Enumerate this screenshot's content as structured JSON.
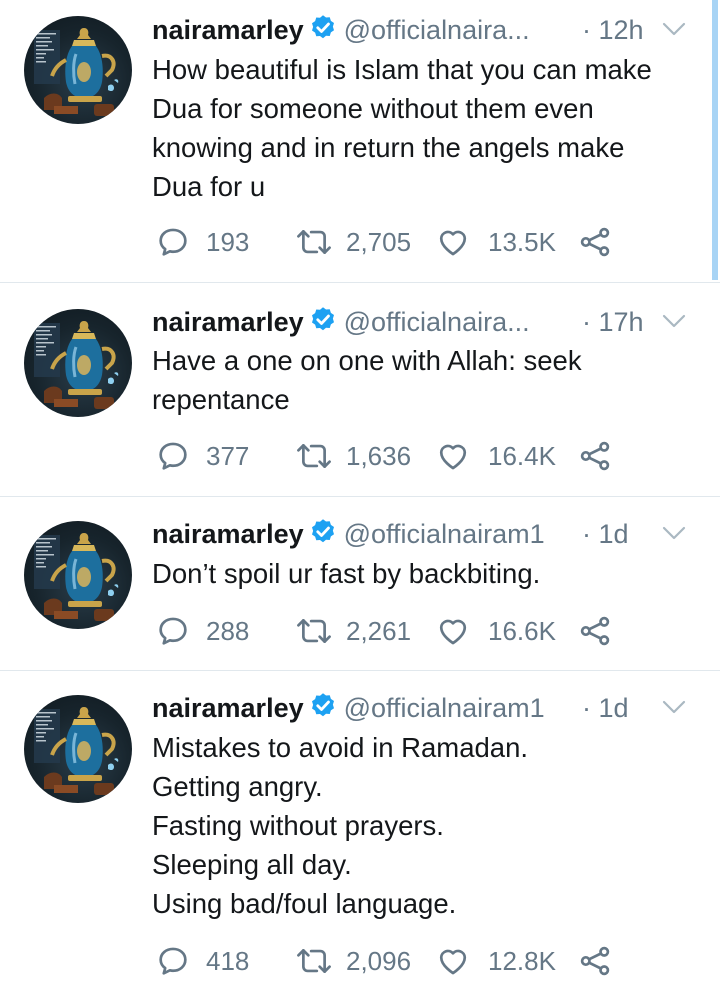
{
  "tweets": [
    {
      "name": "nairamarley",
      "handle": "@officialnaira...",
      "time": "· 12h",
      "lines": [
        "How beautiful is Islam that you can make",
        "Dua for someone without them even",
        "knowing and in return the angels make",
        "Dua for u"
      ],
      "replies": "193",
      "retweets": "2,705",
      "likes": "13.5K"
    },
    {
      "name": "nairamarley",
      "handle": "@officialnaira...",
      "time": "· 17h",
      "lines": [
        "Have a one on one with Allah: seek",
        "repentance"
      ],
      "replies": "377",
      "retweets": "1,636",
      "likes": "16.4K"
    },
    {
      "name": "nairamarley",
      "handle": "@officialnairam1",
      "time": "· 1d",
      "lines": [
        "Don’t spoil ur fast by backbiting."
      ],
      "replies": "288",
      "retweets": "2,261",
      "likes": "16.6K"
    },
    {
      "name": "nairamarley",
      "handle": "@officialnairam1",
      "time": "· 1d",
      "lines": [
        "Mistakes to avoid in Ramadan.",
        "Getting angry.",
        "Fasting without prayers.",
        "Sleeping all day.",
        "Using bad/foul language."
      ],
      "replies": "418",
      "retweets": "2,096",
      "likes": "12.8K"
    }
  ],
  "icons": {
    "verified": "verified-badge-icon",
    "caret": "chevron-down-icon",
    "reply": "reply-icon",
    "retweet": "retweet-icon",
    "like": "heart-icon",
    "share": "share-icon"
  },
  "colors": {
    "text": "#14171a",
    "secondary": "#657786",
    "verified": "#1da1f2",
    "divider": "#e1e8ed"
  }
}
